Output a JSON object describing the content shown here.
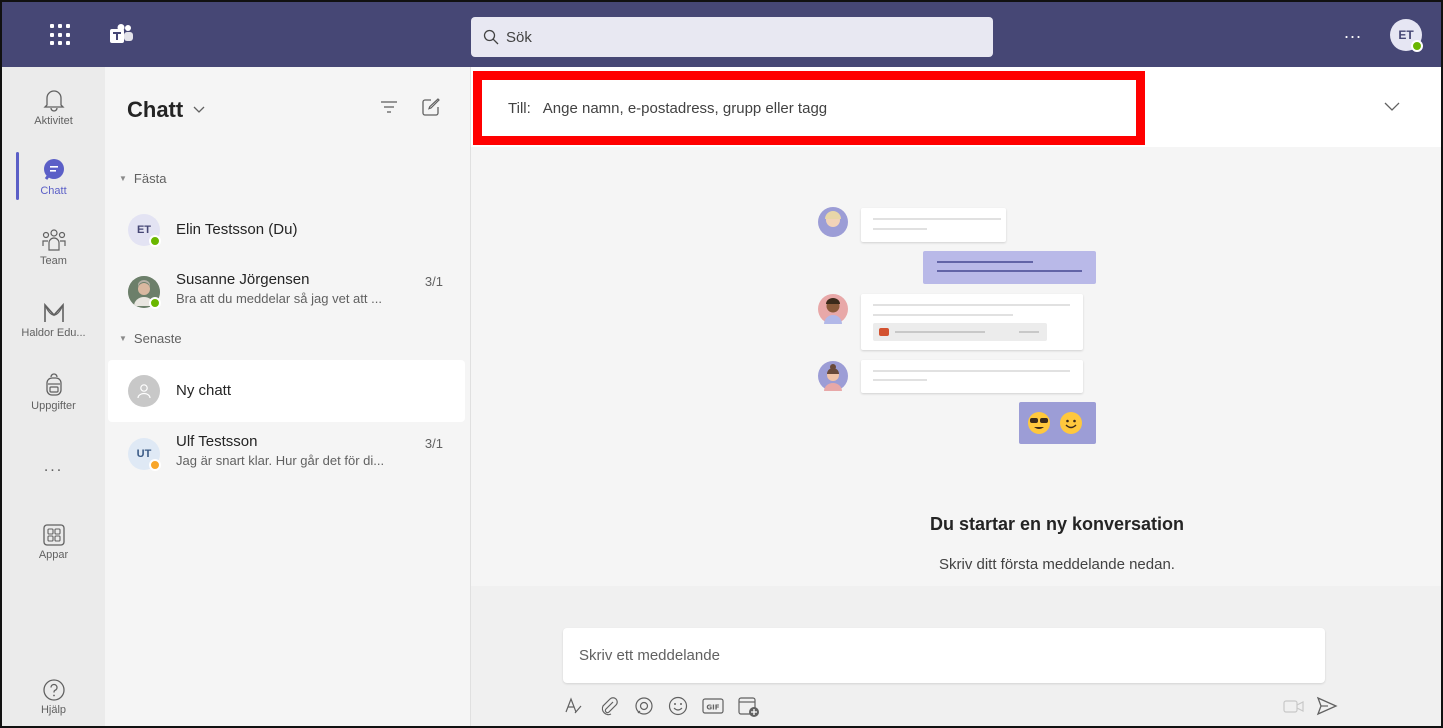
{
  "topbar": {
    "search_placeholder": "Sök",
    "more_label": "...",
    "user_initials": "ET"
  },
  "rail": {
    "items": [
      {
        "label": "Aktivitet",
        "icon": "bell-icon"
      },
      {
        "label": "Chatt",
        "icon": "chat-icon",
        "active": true
      },
      {
        "label": "Team",
        "icon": "team-icon"
      },
      {
        "label": "Haldor Edu...",
        "icon": "haldor-icon"
      },
      {
        "label": "Uppgifter",
        "icon": "backpack-icon"
      },
      {
        "label": "...",
        "icon": "more-icon"
      },
      {
        "label": "Appar",
        "icon": "apps-icon"
      },
      {
        "label": "Hjälp",
        "icon": "help-icon"
      }
    ]
  },
  "chatlist": {
    "title": "Chatt",
    "sections": [
      {
        "label": "Fästa"
      },
      {
        "label": "Senaste"
      }
    ],
    "items": [
      {
        "initials": "ET",
        "name": "Elin Testsson (Du)",
        "preview": "",
        "date": "",
        "presence": "available"
      },
      {
        "initials": "",
        "name": "Susanne Jörgensen",
        "preview": "Bra att du meddelar så jag vet att ...",
        "date": "3/1",
        "presence": "available"
      },
      {
        "initials": "",
        "name": "Ny chatt",
        "preview": "",
        "date": "",
        "presence": "",
        "selected": true
      },
      {
        "initials": "UT",
        "name": "Ulf Testsson",
        "preview": "Jag är snart klar. Hur går det för di...",
        "date": "3/1",
        "presence": "away"
      }
    ]
  },
  "main": {
    "to_label": "Till:",
    "to_placeholder": "Ange namn, e-postadress, grupp eller tagg",
    "empty_title": "Du startar en ny konversation",
    "empty_subtitle": "Skriv ditt första meddelande nedan.",
    "compose_placeholder": "Skriv ett meddelande",
    "tools": [
      "format-icon",
      "attach-icon",
      "loop-icon",
      "emoji-icon",
      "gif-icon",
      "schedule-meeting-icon"
    ],
    "send_tools": [
      "video-clip-icon",
      "send-icon"
    ]
  },
  "colors": {
    "topbar": "#464775",
    "accent": "#5b5fc7",
    "highlight_box": "#ff0000",
    "presence_available": "#6bb700",
    "presence_away": "#f8a62a"
  }
}
